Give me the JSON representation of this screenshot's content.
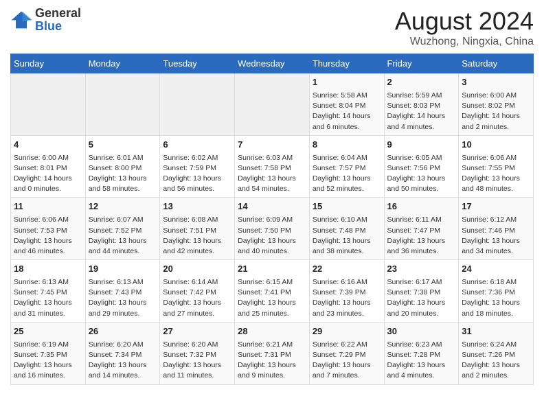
{
  "header": {
    "logo_general": "General",
    "logo_blue": "Blue",
    "title": "August 2024",
    "subtitle": "Wuzhong, Ningxia, China"
  },
  "weekdays": [
    "Sunday",
    "Monday",
    "Tuesday",
    "Wednesday",
    "Thursday",
    "Friday",
    "Saturday"
  ],
  "weeks": [
    [
      {
        "day": "",
        "text": ""
      },
      {
        "day": "",
        "text": ""
      },
      {
        "day": "",
        "text": ""
      },
      {
        "day": "",
        "text": ""
      },
      {
        "day": "1",
        "text": "Sunrise: 5:58 AM\nSunset: 8:04 PM\nDaylight: 14 hours\nand 6 minutes."
      },
      {
        "day": "2",
        "text": "Sunrise: 5:59 AM\nSunset: 8:03 PM\nDaylight: 14 hours\nand 4 minutes."
      },
      {
        "day": "3",
        "text": "Sunrise: 6:00 AM\nSunset: 8:02 PM\nDaylight: 14 hours\nand 2 minutes."
      }
    ],
    [
      {
        "day": "4",
        "text": "Sunrise: 6:00 AM\nSunset: 8:01 PM\nDaylight: 14 hours\nand 0 minutes."
      },
      {
        "day": "5",
        "text": "Sunrise: 6:01 AM\nSunset: 8:00 PM\nDaylight: 13 hours\nand 58 minutes."
      },
      {
        "day": "6",
        "text": "Sunrise: 6:02 AM\nSunset: 7:59 PM\nDaylight: 13 hours\nand 56 minutes."
      },
      {
        "day": "7",
        "text": "Sunrise: 6:03 AM\nSunset: 7:58 PM\nDaylight: 13 hours\nand 54 minutes."
      },
      {
        "day": "8",
        "text": "Sunrise: 6:04 AM\nSunset: 7:57 PM\nDaylight: 13 hours\nand 52 minutes."
      },
      {
        "day": "9",
        "text": "Sunrise: 6:05 AM\nSunset: 7:56 PM\nDaylight: 13 hours\nand 50 minutes."
      },
      {
        "day": "10",
        "text": "Sunrise: 6:06 AM\nSunset: 7:55 PM\nDaylight: 13 hours\nand 48 minutes."
      }
    ],
    [
      {
        "day": "11",
        "text": "Sunrise: 6:06 AM\nSunset: 7:53 PM\nDaylight: 13 hours\nand 46 minutes."
      },
      {
        "day": "12",
        "text": "Sunrise: 6:07 AM\nSunset: 7:52 PM\nDaylight: 13 hours\nand 44 minutes."
      },
      {
        "day": "13",
        "text": "Sunrise: 6:08 AM\nSunset: 7:51 PM\nDaylight: 13 hours\nand 42 minutes."
      },
      {
        "day": "14",
        "text": "Sunrise: 6:09 AM\nSunset: 7:50 PM\nDaylight: 13 hours\nand 40 minutes."
      },
      {
        "day": "15",
        "text": "Sunrise: 6:10 AM\nSunset: 7:48 PM\nDaylight: 13 hours\nand 38 minutes."
      },
      {
        "day": "16",
        "text": "Sunrise: 6:11 AM\nSunset: 7:47 PM\nDaylight: 13 hours\nand 36 minutes."
      },
      {
        "day": "17",
        "text": "Sunrise: 6:12 AM\nSunset: 7:46 PM\nDaylight: 13 hours\nand 34 minutes."
      }
    ],
    [
      {
        "day": "18",
        "text": "Sunrise: 6:13 AM\nSunset: 7:45 PM\nDaylight: 13 hours\nand 31 minutes."
      },
      {
        "day": "19",
        "text": "Sunrise: 6:13 AM\nSunset: 7:43 PM\nDaylight: 13 hours\nand 29 minutes."
      },
      {
        "day": "20",
        "text": "Sunrise: 6:14 AM\nSunset: 7:42 PM\nDaylight: 13 hours\nand 27 minutes."
      },
      {
        "day": "21",
        "text": "Sunrise: 6:15 AM\nSunset: 7:41 PM\nDaylight: 13 hours\nand 25 minutes."
      },
      {
        "day": "22",
        "text": "Sunrise: 6:16 AM\nSunset: 7:39 PM\nDaylight: 13 hours\nand 23 minutes."
      },
      {
        "day": "23",
        "text": "Sunrise: 6:17 AM\nSunset: 7:38 PM\nDaylight: 13 hours\nand 20 minutes."
      },
      {
        "day": "24",
        "text": "Sunrise: 6:18 AM\nSunset: 7:36 PM\nDaylight: 13 hours\nand 18 minutes."
      }
    ],
    [
      {
        "day": "25",
        "text": "Sunrise: 6:19 AM\nSunset: 7:35 PM\nDaylight: 13 hours\nand 16 minutes."
      },
      {
        "day": "26",
        "text": "Sunrise: 6:20 AM\nSunset: 7:34 PM\nDaylight: 13 hours\nand 14 minutes."
      },
      {
        "day": "27",
        "text": "Sunrise: 6:20 AM\nSunset: 7:32 PM\nDaylight: 13 hours\nand 11 minutes."
      },
      {
        "day": "28",
        "text": "Sunrise: 6:21 AM\nSunset: 7:31 PM\nDaylight: 13 hours\nand 9 minutes."
      },
      {
        "day": "29",
        "text": "Sunrise: 6:22 AM\nSunset: 7:29 PM\nDaylight: 13 hours\nand 7 minutes."
      },
      {
        "day": "30",
        "text": "Sunrise: 6:23 AM\nSunset: 7:28 PM\nDaylight: 13 hours\nand 4 minutes."
      },
      {
        "day": "31",
        "text": "Sunrise: 6:24 AM\nSunset: 7:26 PM\nDaylight: 13 hours\nand 2 minutes."
      }
    ]
  ]
}
